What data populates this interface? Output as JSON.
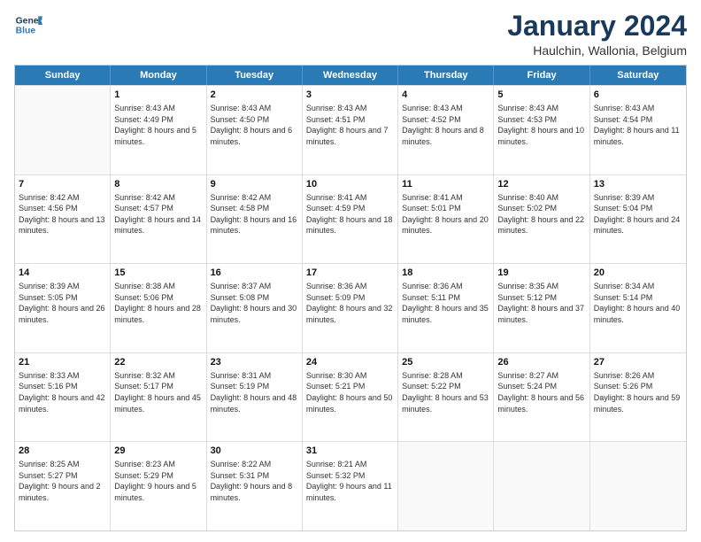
{
  "header": {
    "logo_line1": "General",
    "logo_line2": "Blue",
    "title": "January 2024",
    "subtitle": "Haulchin, Wallonia, Belgium"
  },
  "weekdays": [
    "Sunday",
    "Monday",
    "Tuesday",
    "Wednesday",
    "Thursday",
    "Friday",
    "Saturday"
  ],
  "weeks": [
    [
      {
        "day": "",
        "empty": true
      },
      {
        "day": "1",
        "sunrise": "Sunrise: 8:43 AM",
        "sunset": "Sunset: 4:49 PM",
        "daylight": "Daylight: 8 hours and 5 minutes."
      },
      {
        "day": "2",
        "sunrise": "Sunrise: 8:43 AM",
        "sunset": "Sunset: 4:50 PM",
        "daylight": "Daylight: 8 hours and 6 minutes."
      },
      {
        "day": "3",
        "sunrise": "Sunrise: 8:43 AM",
        "sunset": "Sunset: 4:51 PM",
        "daylight": "Daylight: 8 hours and 7 minutes."
      },
      {
        "day": "4",
        "sunrise": "Sunrise: 8:43 AM",
        "sunset": "Sunset: 4:52 PM",
        "daylight": "Daylight: 8 hours and 8 minutes."
      },
      {
        "day": "5",
        "sunrise": "Sunrise: 8:43 AM",
        "sunset": "Sunset: 4:53 PM",
        "daylight": "Daylight: 8 hours and 10 minutes."
      },
      {
        "day": "6",
        "sunrise": "Sunrise: 8:43 AM",
        "sunset": "Sunset: 4:54 PM",
        "daylight": "Daylight: 8 hours and 11 minutes."
      }
    ],
    [
      {
        "day": "7",
        "sunrise": "Sunrise: 8:42 AM",
        "sunset": "Sunset: 4:56 PM",
        "daylight": "Daylight: 8 hours and 13 minutes."
      },
      {
        "day": "8",
        "sunrise": "Sunrise: 8:42 AM",
        "sunset": "Sunset: 4:57 PM",
        "daylight": "Daylight: 8 hours and 14 minutes."
      },
      {
        "day": "9",
        "sunrise": "Sunrise: 8:42 AM",
        "sunset": "Sunset: 4:58 PM",
        "daylight": "Daylight: 8 hours and 16 minutes."
      },
      {
        "day": "10",
        "sunrise": "Sunrise: 8:41 AM",
        "sunset": "Sunset: 4:59 PM",
        "daylight": "Daylight: 8 hours and 18 minutes."
      },
      {
        "day": "11",
        "sunrise": "Sunrise: 8:41 AM",
        "sunset": "Sunset: 5:01 PM",
        "daylight": "Daylight: 8 hours and 20 minutes."
      },
      {
        "day": "12",
        "sunrise": "Sunrise: 8:40 AM",
        "sunset": "Sunset: 5:02 PM",
        "daylight": "Daylight: 8 hours and 22 minutes."
      },
      {
        "day": "13",
        "sunrise": "Sunrise: 8:39 AM",
        "sunset": "Sunset: 5:04 PM",
        "daylight": "Daylight: 8 hours and 24 minutes."
      }
    ],
    [
      {
        "day": "14",
        "sunrise": "Sunrise: 8:39 AM",
        "sunset": "Sunset: 5:05 PM",
        "daylight": "Daylight: 8 hours and 26 minutes."
      },
      {
        "day": "15",
        "sunrise": "Sunrise: 8:38 AM",
        "sunset": "Sunset: 5:06 PM",
        "daylight": "Daylight: 8 hours and 28 minutes."
      },
      {
        "day": "16",
        "sunrise": "Sunrise: 8:37 AM",
        "sunset": "Sunset: 5:08 PM",
        "daylight": "Daylight: 8 hours and 30 minutes."
      },
      {
        "day": "17",
        "sunrise": "Sunrise: 8:36 AM",
        "sunset": "Sunset: 5:09 PM",
        "daylight": "Daylight: 8 hours and 32 minutes."
      },
      {
        "day": "18",
        "sunrise": "Sunrise: 8:36 AM",
        "sunset": "Sunset: 5:11 PM",
        "daylight": "Daylight: 8 hours and 35 minutes."
      },
      {
        "day": "19",
        "sunrise": "Sunrise: 8:35 AM",
        "sunset": "Sunset: 5:12 PM",
        "daylight": "Daylight: 8 hours and 37 minutes."
      },
      {
        "day": "20",
        "sunrise": "Sunrise: 8:34 AM",
        "sunset": "Sunset: 5:14 PM",
        "daylight": "Daylight: 8 hours and 40 minutes."
      }
    ],
    [
      {
        "day": "21",
        "sunrise": "Sunrise: 8:33 AM",
        "sunset": "Sunset: 5:16 PM",
        "daylight": "Daylight: 8 hours and 42 minutes."
      },
      {
        "day": "22",
        "sunrise": "Sunrise: 8:32 AM",
        "sunset": "Sunset: 5:17 PM",
        "daylight": "Daylight: 8 hours and 45 minutes."
      },
      {
        "day": "23",
        "sunrise": "Sunrise: 8:31 AM",
        "sunset": "Sunset: 5:19 PM",
        "daylight": "Daylight: 8 hours and 48 minutes."
      },
      {
        "day": "24",
        "sunrise": "Sunrise: 8:30 AM",
        "sunset": "Sunset: 5:21 PM",
        "daylight": "Daylight: 8 hours and 50 minutes."
      },
      {
        "day": "25",
        "sunrise": "Sunrise: 8:28 AM",
        "sunset": "Sunset: 5:22 PM",
        "daylight": "Daylight: 8 hours and 53 minutes."
      },
      {
        "day": "26",
        "sunrise": "Sunrise: 8:27 AM",
        "sunset": "Sunset: 5:24 PM",
        "daylight": "Daylight: 8 hours and 56 minutes."
      },
      {
        "day": "27",
        "sunrise": "Sunrise: 8:26 AM",
        "sunset": "Sunset: 5:26 PM",
        "daylight": "Daylight: 8 hours and 59 minutes."
      }
    ],
    [
      {
        "day": "28",
        "sunrise": "Sunrise: 8:25 AM",
        "sunset": "Sunset: 5:27 PM",
        "daylight": "Daylight: 9 hours and 2 minutes."
      },
      {
        "day": "29",
        "sunrise": "Sunrise: 8:23 AM",
        "sunset": "Sunset: 5:29 PM",
        "daylight": "Daylight: 9 hours and 5 minutes."
      },
      {
        "day": "30",
        "sunrise": "Sunrise: 8:22 AM",
        "sunset": "Sunset: 5:31 PM",
        "daylight": "Daylight: 9 hours and 8 minutes."
      },
      {
        "day": "31",
        "sunrise": "Sunrise: 8:21 AM",
        "sunset": "Sunset: 5:32 PM",
        "daylight": "Daylight: 9 hours and 11 minutes."
      },
      {
        "day": "",
        "empty": true
      },
      {
        "day": "",
        "empty": true
      },
      {
        "day": "",
        "empty": true
      }
    ]
  ]
}
